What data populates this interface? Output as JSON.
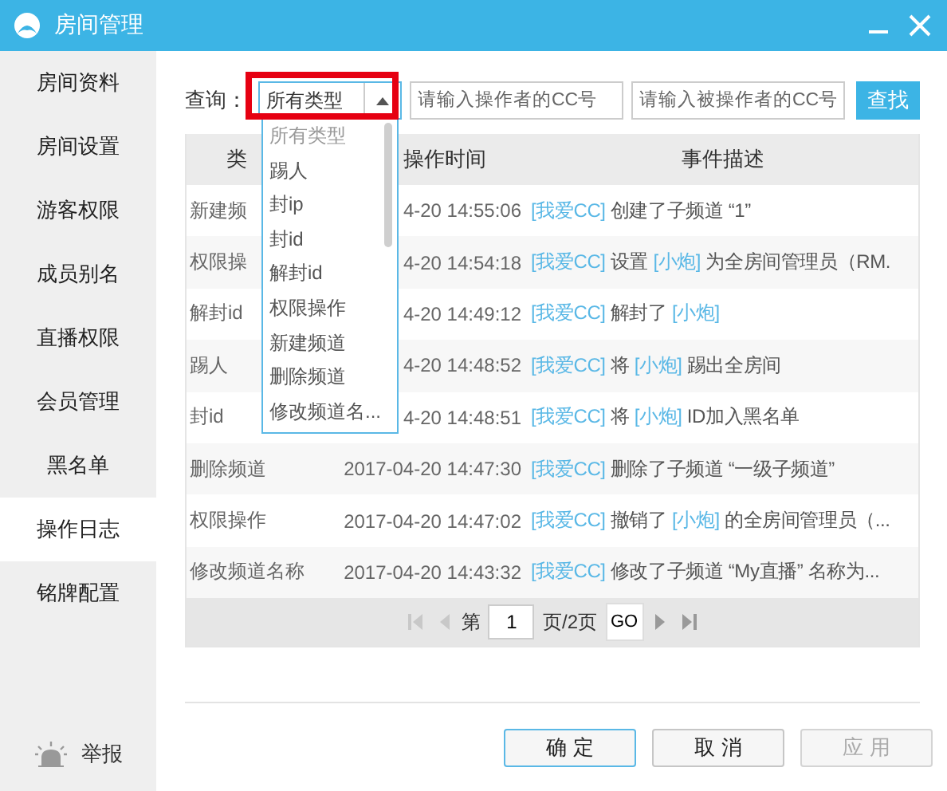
{
  "window": {
    "title": "房间管理"
  },
  "sidebar": {
    "items": [
      {
        "label": "房间资料",
        "selected": false
      },
      {
        "label": "房间设置",
        "selected": false
      },
      {
        "label": "游客权限",
        "selected": false
      },
      {
        "label": "成员别名",
        "selected": false
      },
      {
        "label": "直播权限",
        "selected": false
      },
      {
        "label": "会员管理",
        "selected": false
      },
      {
        "label": "黑名单",
        "selected": false
      },
      {
        "label": "操作日志",
        "selected": true
      },
      {
        "label": "铭牌配置",
        "selected": false
      }
    ],
    "report": "举报"
  },
  "query": {
    "label": "查询：",
    "type_select": {
      "value": "所有类型",
      "expanded": true,
      "options": [
        {
          "label": "所有类型",
          "selected": true
        },
        {
          "label": "踢人",
          "selected": false
        },
        {
          "label": "封ip",
          "selected": false
        },
        {
          "label": "封id",
          "selected": false
        },
        {
          "label": "解封id",
          "selected": false
        },
        {
          "label": "权限操作",
          "selected": false
        },
        {
          "label": "新建频道",
          "selected": false
        },
        {
          "label": "删除频道",
          "selected": false
        },
        {
          "label": "修改频道名...",
          "selected": false
        }
      ]
    },
    "operator_field": {
      "placeholder": "请输入操作者的CC号"
    },
    "target_field": {
      "placeholder": "请输入被操作者的CC号"
    },
    "search_button": "查找"
  },
  "table": {
    "columns": [
      "类",
      "操作时间",
      "事件描述"
    ],
    "rows": [
      {
        "type": "新建频",
        "time": "4-20 14:55:06",
        "description": [
          {
            "kind": "user",
            "text": "[我爱CC]"
          },
          {
            "kind": "plain",
            "text": " 创建了子频道 “1”"
          }
        ]
      },
      {
        "type": "权限操",
        "time": "4-20 14:54:18",
        "description": [
          {
            "kind": "user",
            "text": "[我爱CC]"
          },
          {
            "kind": "plain",
            "text": " 设置 "
          },
          {
            "kind": "user",
            "text": "[小炮]"
          },
          {
            "kind": "plain",
            "text": " 为全房间管理员（RM."
          }
        ]
      },
      {
        "type": "解封id",
        "time": "4-20 14:49:12",
        "description": [
          {
            "kind": "user",
            "text": "[我爱CC]"
          },
          {
            "kind": "plain",
            "text": " 解封了 "
          },
          {
            "kind": "user",
            "text": "[小炮]"
          }
        ]
      },
      {
        "type": "踢人",
        "time": "4-20 14:48:52",
        "description": [
          {
            "kind": "user",
            "text": "[我爱CC]"
          },
          {
            "kind": "plain",
            "text": " 将 "
          },
          {
            "kind": "user",
            "text": "[小炮]"
          },
          {
            "kind": "plain",
            "text": " 踢出全房间"
          }
        ]
      },
      {
        "type": "封id",
        "time": "4-20 14:48:51",
        "description": [
          {
            "kind": "user",
            "text": "[我爱CC]"
          },
          {
            "kind": "plain",
            "text": " 将 "
          },
          {
            "kind": "user",
            "text": "[小炮]"
          },
          {
            "kind": "plain",
            "text": " ID加入黑名单"
          }
        ]
      },
      {
        "type": "删除频道",
        "time": "2017-04-20 14:47:30",
        "description": [
          {
            "kind": "user",
            "text": "[我爱CC]"
          },
          {
            "kind": "plain",
            "text": " 删除了子频道 “一级子频道”"
          }
        ]
      },
      {
        "type": "权限操作",
        "time": "2017-04-20 14:47:02",
        "description": [
          {
            "kind": "user",
            "text": "[我爱CC]"
          },
          {
            "kind": "plain",
            "text": " 撤销了 "
          },
          {
            "kind": "user",
            "text": "[小炮]"
          },
          {
            "kind": "plain",
            "text": " 的全房间管理员（..."
          }
        ]
      },
      {
        "type": "修改频道名称",
        "time": "2017-04-20 14:43:32",
        "description": [
          {
            "kind": "user",
            "text": "[我爱CC]"
          },
          {
            "kind": "plain",
            "text": " 修改了子频道 “My直播” 名称为..."
          }
        ]
      }
    ]
  },
  "pagination": {
    "prefix": "第",
    "page": "1",
    "suffix": "页/2页",
    "go": "GO"
  },
  "buttons": [
    {
      "label": "确 定",
      "disabled": false,
      "default": true
    },
    {
      "label": "取 消",
      "disabled": false,
      "default": false
    },
    {
      "label": "应 用",
      "disabled": true,
      "default": false
    }
  ]
}
